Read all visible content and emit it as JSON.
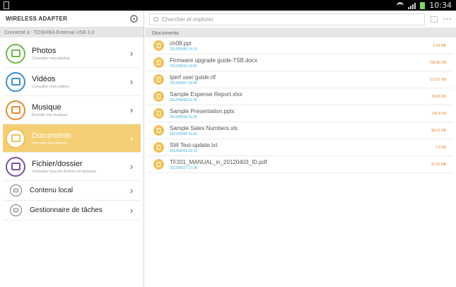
{
  "status_bar": {
    "time": "10:34"
  },
  "app": {
    "title": "Wireless Adapter"
  },
  "connection": {
    "text": "Connecté à :  TOSHIBA  External USB 3.0"
  },
  "categories": [
    {
      "label": "Photos",
      "subtitle": "Consulter mes photos",
      "color": "#6fb84a",
      "selected": false
    },
    {
      "label": "Vidéos",
      "subtitle": "Consulter mes vidéos",
      "color": "#3d8fd0",
      "selected": false
    },
    {
      "label": "Musique",
      "subtitle": "Ecouter ma musique",
      "color": "#e88a2f",
      "selected": false
    },
    {
      "label": "Documents",
      "subtitle": "Voir mes documents",
      "color": "#f0c259",
      "selected": true
    },
    {
      "label": "Fichier/dossier",
      "subtitle": "Consulter tous les fichiers et dossiers",
      "color": "#7b4fa8",
      "selected": false
    }
  ],
  "local_items": [
    {
      "label": "Contenu local",
      "icon": "local-content-icon"
    },
    {
      "label": "Gestionnaire de tâches",
      "icon": "task-manager-icon"
    }
  ],
  "search": {
    "placeholder": "Chercher et explorer"
  },
  "section": {
    "title": "Documents"
  },
  "files": [
    {
      "name": "ch08.ppt",
      "date": "2012/08/06 14:16",
      "size": "2.24 MB"
    },
    {
      "name": "Firmware upgrade guide-TSB.docx",
      "date": "2012/08/16 16:56",
      "size": "239.80 KB"
    },
    {
      "name": "Iperf user guide.rtf",
      "date": "2012/09/07 09:46",
      "size": "113.61 KB"
    },
    {
      "name": "Sample Expense Report.xlsx",
      "date": "2012/05/08 01:36",
      "size": "16.80 KB"
    },
    {
      "name": "Sample Presentation.pptx",
      "date": "2012/05/08 16:36",
      "size": "145.8 KB"
    },
    {
      "name": "Sample Sales Numbers.xls",
      "date": "2012/05/08 16:36",
      "size": "88.21 KB"
    },
    {
      "name": "SW Test-update.txt",
      "date": "2012/06/01 05:16",
      "size": "7.4 KB"
    },
    {
      "name": "TF201_MANUAL_in_20120403_ID.pdf",
      "date": "2012/06/27 17:28",
      "size": "15.25 MB"
    }
  ],
  "colors": {
    "accent": "#f5cf73",
    "date": "#3cb0d8",
    "size": "#e8862e"
  }
}
